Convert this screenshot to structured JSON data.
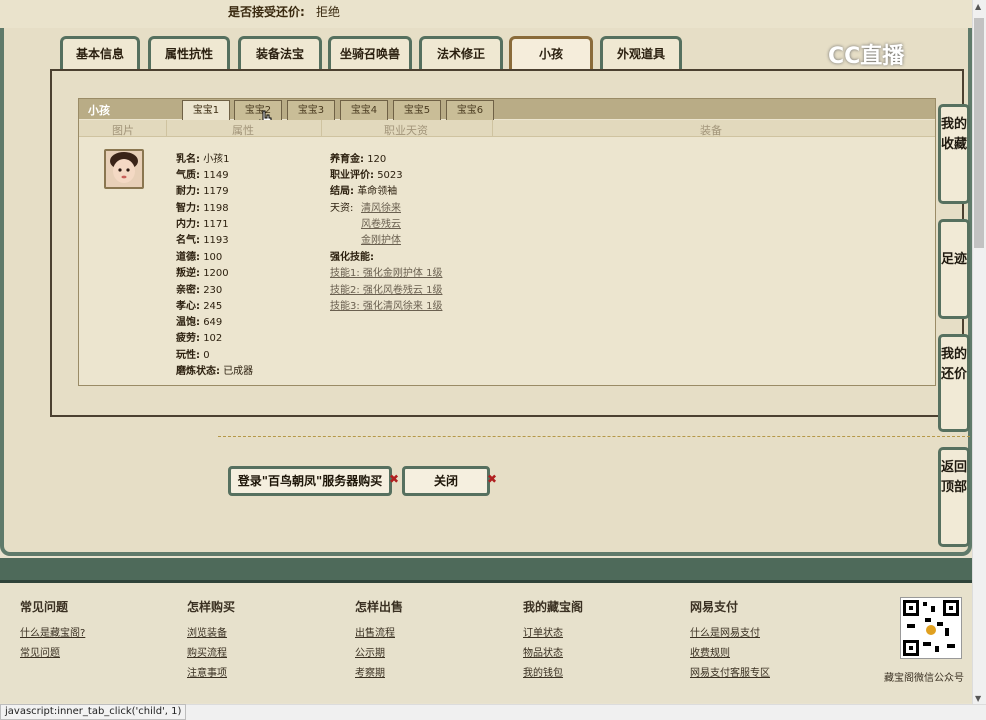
{
  "header": {
    "accept_counter_label": "是否接受还价:",
    "accept_counter_value": "拒绝"
  },
  "outer_tabs": [
    "基本信息",
    "属性抗性",
    "装备法宝",
    "坐骑召唤兽",
    "法术修正",
    "小孩",
    "外观道具"
  ],
  "outer_active": "小孩",
  "watermark": "CC直播",
  "panel": {
    "title": "小孩",
    "inner_tabs": [
      "宝宝1",
      "宝宝2",
      "宝宝3",
      "宝宝4",
      "宝宝5",
      "宝宝6"
    ],
    "columns": [
      "图片",
      "属性",
      "职业天资",
      "装备"
    ],
    "attributes": [
      {
        "k": "乳名:",
        "v": "小孩1"
      },
      {
        "k": "气质:",
        "v": "1149"
      },
      {
        "k": "耐力:",
        "v": "1179"
      },
      {
        "k": "智力:",
        "v": "1198"
      },
      {
        "k": "内力:",
        "v": "1171"
      },
      {
        "k": "名气:",
        "v": "1193"
      },
      {
        "k": "道德:",
        "v": "100"
      },
      {
        "k": "叛逆:",
        "v": "1200"
      },
      {
        "k": "亲密:",
        "v": "230"
      },
      {
        "k": "孝心:",
        "v": "245"
      },
      {
        "k": "温饱:",
        "v": "649"
      },
      {
        "k": "疲劳:",
        "v": "102"
      },
      {
        "k": "玩性:",
        "v": "0"
      },
      {
        "k": "磨炼状态:",
        "v": "已成器"
      }
    ],
    "career": {
      "raising_gold_label": "养育金:",
      "raising_gold": "120",
      "eval_label": "职业评价:",
      "eval": "5023",
      "ending_label": "结局:",
      "ending": "革命领袖",
      "talent_label": "天资:",
      "talents": [
        "清风徐来",
        "风卷残云",
        "金刚护体"
      ],
      "skills_label": "强化技能:",
      "skills": [
        "技能1: 强化金刚护体 1级",
        "技能2: 强化风卷残云 1级",
        "技能3: 强化清风徐来 1级"
      ]
    }
  },
  "buttons": {
    "login_buy": "登录\"百鸟朝凤\"服务器购买",
    "close": "关闭"
  },
  "side_buttons": [
    "我的收藏",
    "足迹",
    "我的还价",
    "返回顶部"
  ],
  "footer": {
    "cols": [
      {
        "title": "常见问题",
        "links": [
          "什么是藏宝阁?",
          "常见问题"
        ]
      },
      {
        "title": "怎样购买",
        "links": [
          "浏览装备",
          "购买流程",
          "注意事项"
        ]
      },
      {
        "title": "怎样出售",
        "links": [
          "出售流程",
          "公示期",
          "考察期"
        ]
      },
      {
        "title": "我的藏宝阁",
        "links": [
          "订单状态",
          "物品状态",
          "我的钱包"
        ]
      },
      {
        "title": "网易支付",
        "links": [
          "什么是网易支付",
          "收费规则",
          "网易支付客服专区"
        ]
      }
    ],
    "qr_caption": "藏宝阁微信公众号"
  },
  "status_bar": "javascript:inner_tab_click('child', 1)"
}
